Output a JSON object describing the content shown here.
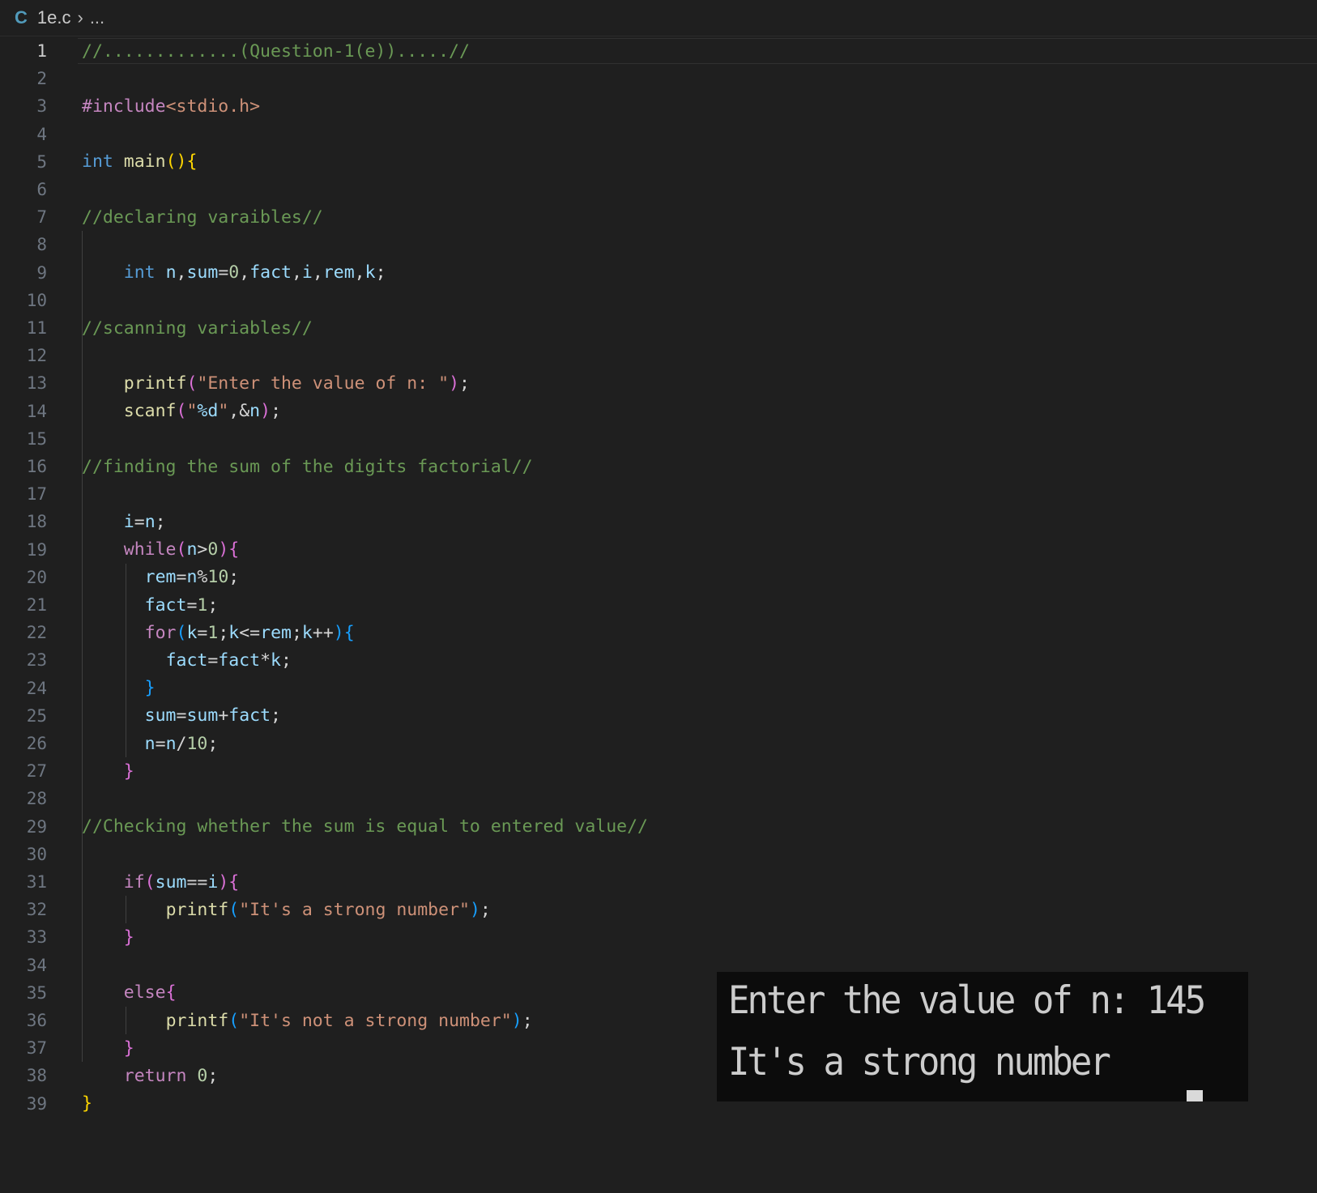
{
  "breadcrumb": {
    "lang_icon": "C",
    "file": "1e.c",
    "separator": "›",
    "ellipsis": "..."
  },
  "editor": {
    "current_line": 1,
    "lines": [
      {
        "n": "1",
        "tokens": [
          [
            "t-comment",
            "//.............(Question-1(e)).....//"
          ]
        ]
      },
      {
        "n": "2",
        "tokens": []
      },
      {
        "n": "3",
        "tokens": [
          [
            "t-include",
            "#include"
          ],
          [
            "t-str",
            "<stdio.h>"
          ]
        ]
      },
      {
        "n": "4",
        "tokens": []
      },
      {
        "n": "5",
        "tokens": [
          [
            "t-type",
            "int"
          ],
          [
            "t-op",
            " "
          ],
          [
            "t-func",
            "main"
          ],
          [
            "br1",
            "()"
          ],
          [
            "br1",
            "{"
          ]
        ]
      },
      {
        "n": "6",
        "tokens": []
      },
      {
        "n": "7",
        "tokens": [
          [
            "t-comment",
            "//declaring varaibles//"
          ]
        ]
      },
      {
        "n": "8",
        "tokens": []
      },
      {
        "n": "9",
        "tokens": [
          [
            "t-op",
            "    "
          ],
          [
            "t-type",
            "int"
          ],
          [
            "t-op",
            " "
          ],
          [
            "t-var",
            "n"
          ],
          [
            "t-op",
            ","
          ],
          [
            "t-var",
            "sum"
          ],
          [
            "t-op",
            "="
          ],
          [
            "t-num",
            "0"
          ],
          [
            "t-op",
            ","
          ],
          [
            "t-var",
            "fact"
          ],
          [
            "t-op",
            ","
          ],
          [
            "t-var",
            "i"
          ],
          [
            "t-op",
            ","
          ],
          [
            "t-var",
            "rem"
          ],
          [
            "t-op",
            ","
          ],
          [
            "t-var",
            "k"
          ],
          [
            "t-op",
            ";"
          ]
        ]
      },
      {
        "n": "10",
        "tokens": []
      },
      {
        "n": "11",
        "tokens": [
          [
            "t-comment",
            "//scanning variables//"
          ]
        ]
      },
      {
        "n": "12",
        "tokens": []
      },
      {
        "n": "13",
        "tokens": [
          [
            "t-op",
            "    "
          ],
          [
            "t-func",
            "printf"
          ],
          [
            "br2",
            "("
          ],
          [
            "t-str",
            "\"Enter the value of n: \""
          ],
          [
            "br2",
            ")"
          ],
          [
            "t-op",
            ";"
          ]
        ]
      },
      {
        "n": "14",
        "tokens": [
          [
            "t-op",
            "    "
          ],
          [
            "t-func",
            "scanf"
          ],
          [
            "br2",
            "("
          ],
          [
            "t-str",
            "\""
          ],
          [
            "t-var",
            "%d"
          ],
          [
            "t-str",
            "\""
          ],
          [
            "t-op",
            ",&"
          ],
          [
            "t-var",
            "n"
          ],
          [
            "br2",
            ")"
          ],
          [
            "t-op",
            ";"
          ]
        ]
      },
      {
        "n": "15",
        "tokens": []
      },
      {
        "n": "16",
        "tokens": [
          [
            "t-comment",
            "//finding the sum of the digits factorial//"
          ]
        ]
      },
      {
        "n": "17",
        "tokens": []
      },
      {
        "n": "18",
        "tokens": [
          [
            "t-op",
            "    "
          ],
          [
            "t-var",
            "i"
          ],
          [
            "t-op",
            "="
          ],
          [
            "t-var",
            "n"
          ],
          [
            "t-op",
            ";"
          ]
        ]
      },
      {
        "n": "19",
        "tokens": [
          [
            "t-op",
            "    "
          ],
          [
            "t-ctrl",
            "while"
          ],
          [
            "br2",
            "("
          ],
          [
            "t-var",
            "n"
          ],
          [
            "t-op",
            ">"
          ],
          [
            "t-num",
            "0"
          ],
          [
            "br2",
            ")"
          ],
          [
            "br2",
            "{"
          ]
        ]
      },
      {
        "n": "20",
        "tokens": [
          [
            "t-op",
            "      "
          ],
          [
            "t-var",
            "rem"
          ],
          [
            "t-op",
            "="
          ],
          [
            "t-var",
            "n"
          ],
          [
            "t-op",
            "%"
          ],
          [
            "t-num",
            "10"
          ],
          [
            "t-op",
            ";"
          ]
        ]
      },
      {
        "n": "21",
        "tokens": [
          [
            "t-op",
            "      "
          ],
          [
            "t-var",
            "fact"
          ],
          [
            "t-op",
            "="
          ],
          [
            "t-num",
            "1"
          ],
          [
            "t-op",
            ";"
          ]
        ]
      },
      {
        "n": "22",
        "tokens": [
          [
            "t-op",
            "      "
          ],
          [
            "t-ctrl",
            "for"
          ],
          [
            "br3",
            "("
          ],
          [
            "t-var",
            "k"
          ],
          [
            "t-op",
            "="
          ],
          [
            "t-num",
            "1"
          ],
          [
            "t-op",
            ";"
          ],
          [
            "t-var",
            "k"
          ],
          [
            "t-op",
            "<="
          ],
          [
            "t-var",
            "rem"
          ],
          [
            "t-op",
            ";"
          ],
          [
            "t-var",
            "k"
          ],
          [
            "t-op",
            "++"
          ],
          [
            "br3",
            ")"
          ],
          [
            "br3",
            "{"
          ]
        ]
      },
      {
        "n": "23",
        "tokens": [
          [
            "t-op",
            "        "
          ],
          [
            "t-var",
            "fact"
          ],
          [
            "t-op",
            "="
          ],
          [
            "t-var",
            "fact"
          ],
          [
            "t-op",
            "*"
          ],
          [
            "t-var",
            "k"
          ],
          [
            "t-op",
            ";"
          ]
        ]
      },
      {
        "n": "24",
        "tokens": [
          [
            "t-op",
            "      "
          ],
          [
            "br3",
            "}"
          ]
        ]
      },
      {
        "n": "25",
        "tokens": [
          [
            "t-op",
            "      "
          ],
          [
            "t-var",
            "sum"
          ],
          [
            "t-op",
            "="
          ],
          [
            "t-var",
            "sum"
          ],
          [
            "t-op",
            "+"
          ],
          [
            "t-var",
            "fact"
          ],
          [
            "t-op",
            ";"
          ]
        ]
      },
      {
        "n": "26",
        "tokens": [
          [
            "t-op",
            "      "
          ],
          [
            "t-var",
            "n"
          ],
          [
            "t-op",
            "="
          ],
          [
            "t-var",
            "n"
          ],
          [
            "t-op",
            "/"
          ],
          [
            "t-num",
            "10"
          ],
          [
            "t-op",
            ";"
          ]
        ]
      },
      {
        "n": "27",
        "tokens": [
          [
            "t-op",
            "    "
          ],
          [
            "br2",
            "}"
          ]
        ]
      },
      {
        "n": "28",
        "tokens": []
      },
      {
        "n": "29",
        "tokens": [
          [
            "t-comment",
            "//Checking whether the sum is equal to entered value//"
          ]
        ]
      },
      {
        "n": "30",
        "tokens": []
      },
      {
        "n": "31",
        "tokens": [
          [
            "t-op",
            "    "
          ],
          [
            "t-ctrl",
            "if"
          ],
          [
            "br2",
            "("
          ],
          [
            "t-var",
            "sum"
          ],
          [
            "t-op",
            "=="
          ],
          [
            "t-var",
            "i"
          ],
          [
            "br2",
            ")"
          ],
          [
            "br2",
            "{"
          ]
        ]
      },
      {
        "n": "32",
        "tokens": [
          [
            "t-op",
            "        "
          ],
          [
            "t-func",
            "printf"
          ],
          [
            "br3",
            "("
          ],
          [
            "t-str",
            "\"It's a strong number\""
          ],
          [
            "br3",
            ")"
          ],
          [
            "t-op",
            ";"
          ]
        ]
      },
      {
        "n": "33",
        "tokens": [
          [
            "t-op",
            "    "
          ],
          [
            "br2",
            "}"
          ]
        ]
      },
      {
        "n": "34",
        "tokens": []
      },
      {
        "n": "35",
        "tokens": [
          [
            "t-op",
            "    "
          ],
          [
            "t-ctrl",
            "else"
          ],
          [
            "br2",
            "{"
          ]
        ]
      },
      {
        "n": "36",
        "tokens": [
          [
            "t-op",
            "        "
          ],
          [
            "t-func",
            "printf"
          ],
          [
            "br3",
            "("
          ],
          [
            "t-str",
            "\"It's not a strong number\""
          ],
          [
            "br3",
            ")"
          ],
          [
            "t-op",
            ";"
          ]
        ]
      },
      {
        "n": "37",
        "tokens": [
          [
            "t-op",
            "    "
          ],
          [
            "br2",
            "}"
          ]
        ]
      },
      {
        "n": "38",
        "tokens": [
          [
            "t-op",
            "    "
          ],
          [
            "t-ctrl",
            "return"
          ],
          [
            "t-op",
            " "
          ],
          [
            "t-num",
            "0"
          ],
          [
            "t-op",
            ";"
          ]
        ]
      },
      {
        "n": "39",
        "tokens": [
          [
            "br1",
            "}"
          ]
        ]
      }
    ]
  },
  "terminal": {
    "lines": [
      "Enter the value of n: 145",
      "It's a strong number"
    ]
  }
}
